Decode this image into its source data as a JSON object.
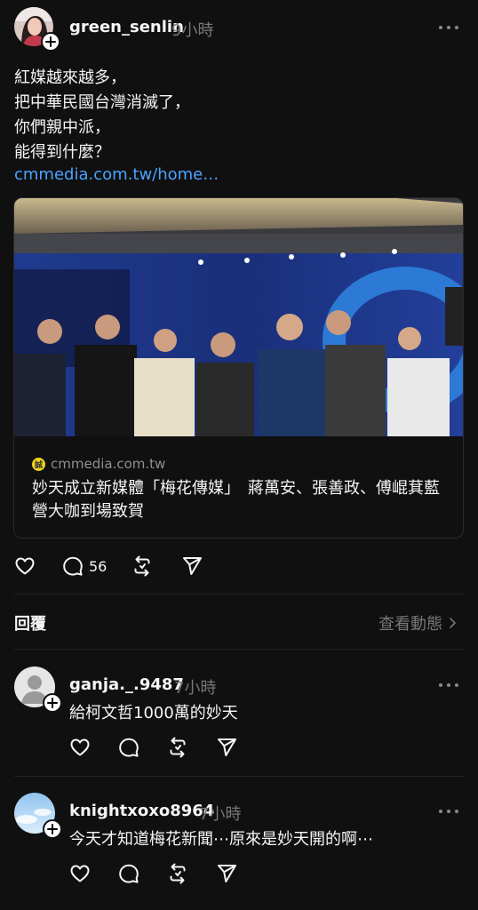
{
  "post": {
    "username": "green_senlin",
    "time": "9小時",
    "text_lines": [
      "紅媒越來越多，",
      "把中華民國台灣消滅了，",
      "你們親中派，",
      "能得到什麼？"
    ],
    "link": "cmmedia.com.tw/home…",
    "card": {
      "domain": "cmmedia.com.tw",
      "title": "妙天成立新媒體「梅花傳媒」　蔣萬安、張善政、傅崐萁藍營大咖到場致賀"
    },
    "actions": {
      "like_icon": "heart-icon",
      "comment_icon": "comment-icon",
      "comment_count": "56",
      "repost_icon": "repost-icon",
      "share_icon": "send-icon"
    }
  },
  "replies_section": {
    "title": "回覆",
    "activity_link": "查看動態"
  },
  "comments": [
    {
      "username": "ganja._.9487",
      "time": "7小時",
      "text": "給柯文哲1000萬的妙天"
    },
    {
      "username": "knightxoxo8964",
      "time": "7小時",
      "text": "今天才知道梅花新聞⋯原來是妙天開的啊⋯"
    }
  ],
  "colors": {
    "background": "#101010",
    "text": "#f3f5f7",
    "muted": "#777777",
    "link": "#4aa3ff",
    "divider": "#242424"
  }
}
